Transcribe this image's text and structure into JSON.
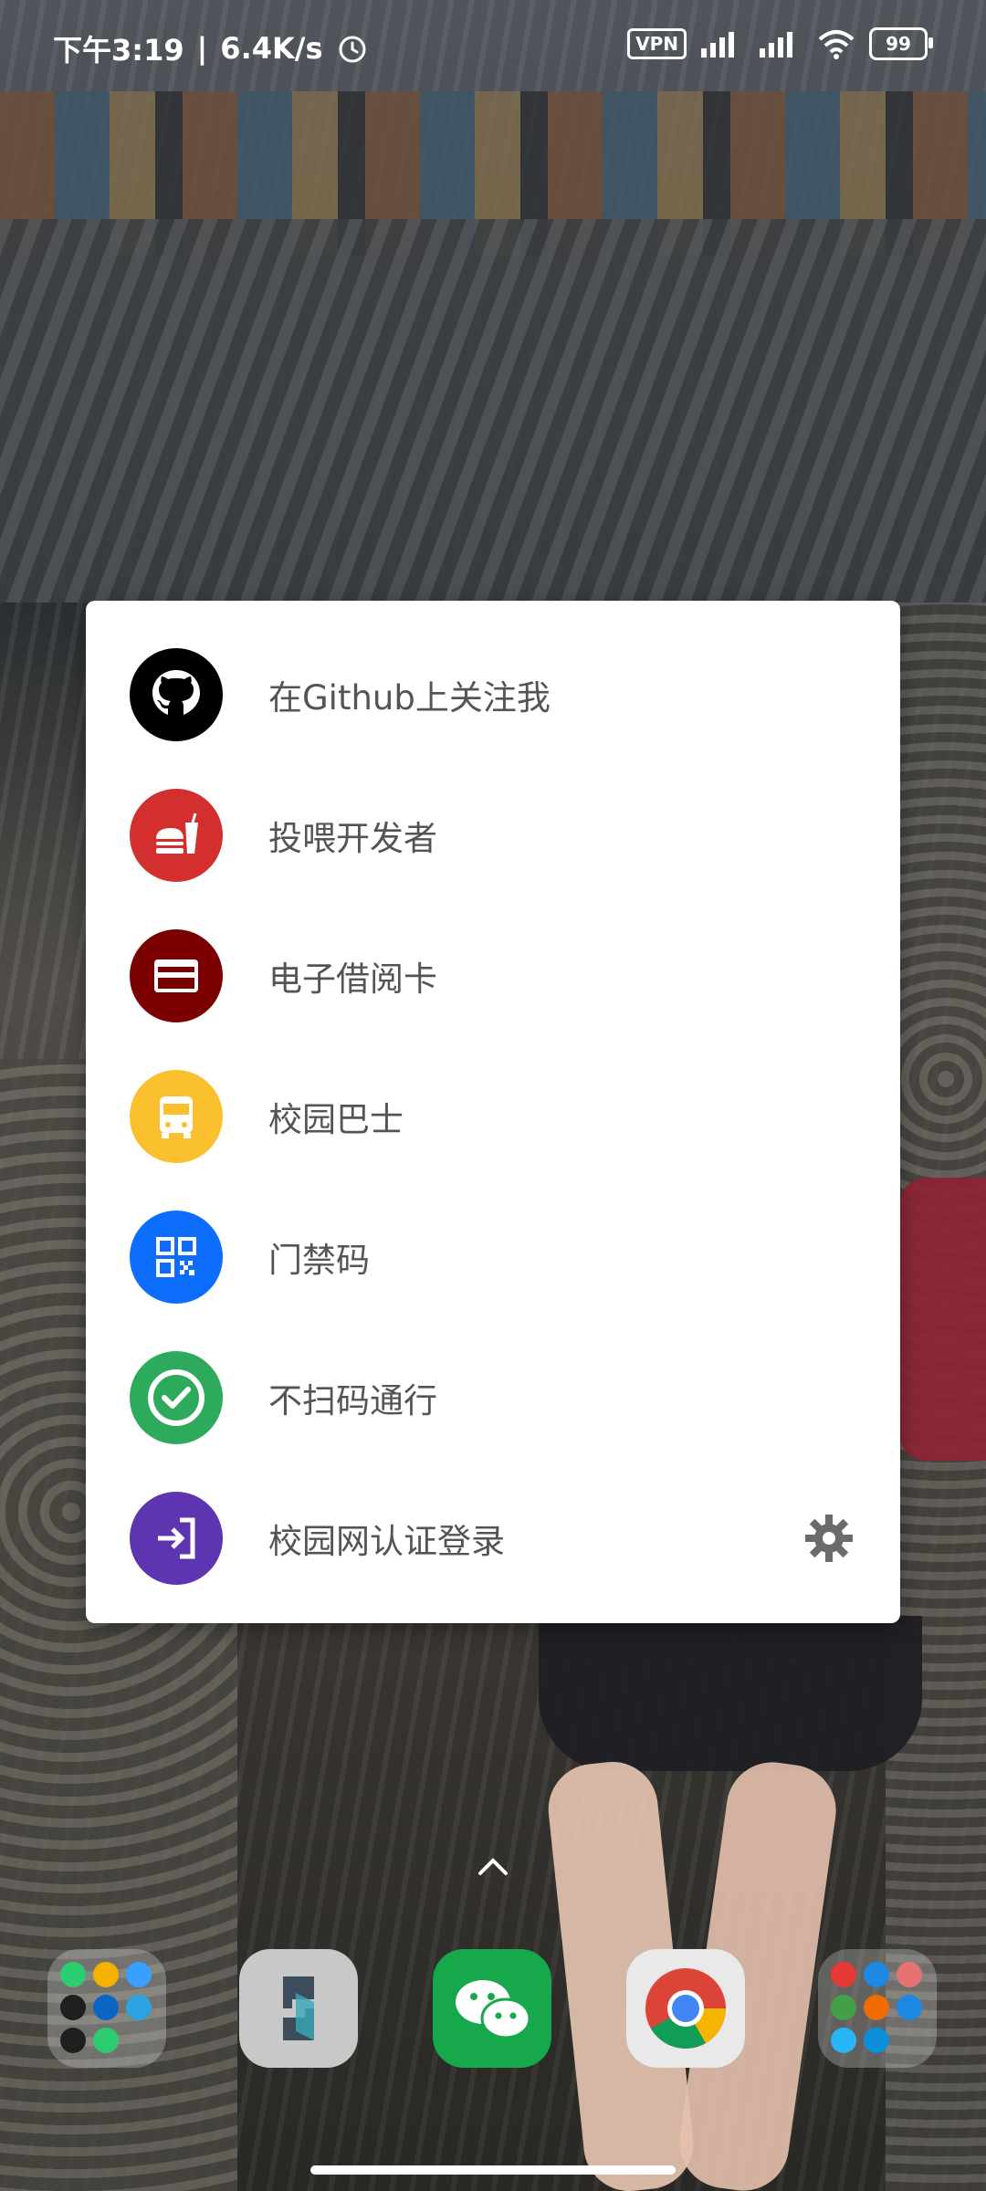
{
  "status_bar": {
    "time": "下午3:19",
    "separator": "|",
    "net_speed": "6.4K/s",
    "vpn": "VPN",
    "battery": "99",
    "icons": [
      "alarm-icon",
      "vpn-icon",
      "signal-hd-icon",
      "signal-hd-icon",
      "wifi-icon",
      "battery-icon"
    ]
  },
  "menu": {
    "items": [
      {
        "label": "在Github上关注我",
        "icon": "github-icon",
        "color": "#000000"
      },
      {
        "label": "投喂开发者",
        "icon": "fastfood-icon",
        "color": "#D32F2F"
      },
      {
        "label": "电子借阅卡",
        "icon": "card-icon",
        "color": "#7B0000"
      },
      {
        "label": "校园巴士",
        "icon": "bus-icon",
        "color": "#FBC02D"
      },
      {
        "label": "门禁码",
        "icon": "qrcode-icon",
        "color": "#0D6EFD"
      },
      {
        "label": "不扫码通行",
        "icon": "check-circle-icon",
        "color": "#2EAA5C"
      },
      {
        "label": "校园网认证登录",
        "icon": "login-icon",
        "color": "#5E35B1"
      }
    ],
    "settings_icon": "gear-icon"
  },
  "dock": {
    "items": [
      "communication-folder",
      "app-icon",
      "wechat-icon",
      "chrome-icon",
      "apps-folder"
    ]
  },
  "colors": {
    "card_bg": "#FFFFFF",
    "label_text": "#545454"
  }
}
